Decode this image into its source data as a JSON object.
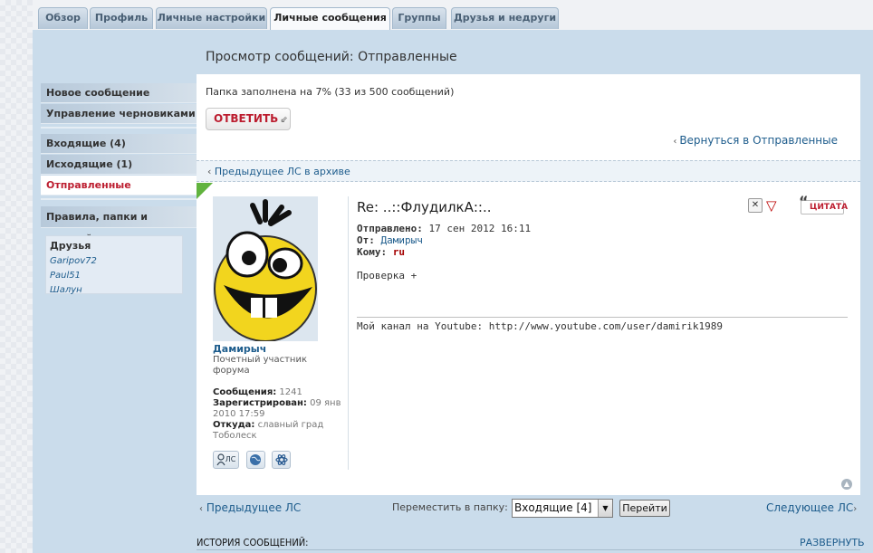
{
  "tabs": [
    "Обзор",
    "Профиль",
    "Личные настройки",
    "Личные сообщения",
    "Группы",
    "Друзья и недруги"
  ],
  "page_title": "Просмотр сообщений: Отправленные",
  "sidebar": {
    "items": [
      "Новое сообщение",
      "Управление черновиками",
      "Входящие (4)",
      "Исходящие (1)",
      "Отправленные",
      "Правила, папки и настройки"
    ],
    "friends_title": "Друзья",
    "friends": [
      "Garipov72",
      "Paul51",
      "Шалун"
    ]
  },
  "folder_info": "Папка заполнена на 7% (33 из 500 сообщений)",
  "reply_label": "ОТВЕТИТЬ",
  "back_link": "Вернуться в Отправленные",
  "prev_archive": "Предыдущее ЛС в архиве",
  "author": {
    "name": "Дамирыч",
    "rank": "Почетный участник форума",
    "posts_label": "Сообщения:",
    "posts": "1241",
    "registered_label": "Зарегистрирован:",
    "registered": "09 янв 2010 17:59",
    "from_label": "Откуда:",
    "from": "славный град Тоболеск",
    "icons": [
      "ЛС"
    ]
  },
  "message": {
    "subject": "Re: ..::ФлудилкА::..",
    "sent_label": "Отправлено:",
    "sent": "17 сен 2012 16:11",
    "from_label": "От:",
    "from": "Дамирыч",
    "to_label": "Кому:",
    "to": "ru",
    "body": "Проверка +",
    "signature": "Мой канал на Youtube: http://www.youtube.com/user/damirik1989",
    "quote_label": "ЦИТАТА"
  },
  "pager": {
    "prev": "Предыдущее ЛС",
    "move_label": "Переместить в папку:",
    "move_value": "Входящие [4]",
    "go_label": "Перейти",
    "next": "Следующее ЛС"
  },
  "history_label": "ИСТОРИЯ СООБЩЕНИЙ:",
  "expand_label": "РАЗВЕРНУТЬ"
}
